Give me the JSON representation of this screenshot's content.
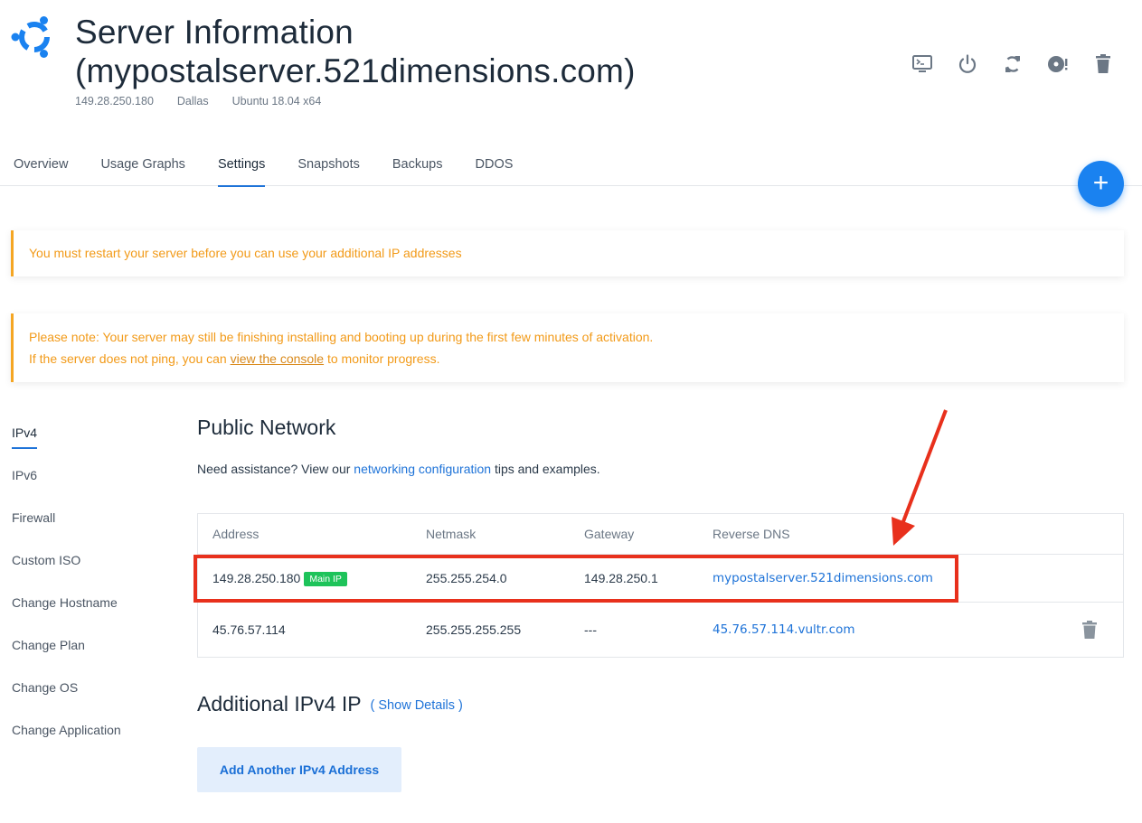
{
  "header": {
    "title_line1": "Server Information",
    "title_line2": "(mypostalserver.521dimensions.com)",
    "ip": "149.28.250.180",
    "location": "Dallas",
    "os": "Ubuntu 18.04 x64",
    "actions": [
      "console-icon",
      "power-icon",
      "restart-icon",
      "reinstall-icon",
      "trash-icon"
    ]
  },
  "tabs": [
    {
      "label": "Overview"
    },
    {
      "label": "Usage Graphs"
    },
    {
      "label": "Settings",
      "active": true
    },
    {
      "label": "Snapshots"
    },
    {
      "label": "Backups"
    },
    {
      "label": "DDOS"
    }
  ],
  "fab": {
    "label": "+"
  },
  "alerts": {
    "restart": "You must restart your server before you can use your additional IP addresses",
    "note_line1": "Please note: Your server may still be finishing installing and booting up during the first few minutes of activation.",
    "note_line2_pre": "If the server does not ping, you can ",
    "note_link": "view the console",
    "note_line2_post": " to monitor progress."
  },
  "sidenav": [
    {
      "label": "IPv4",
      "active": true
    },
    {
      "label": "IPv6"
    },
    {
      "label": "Firewall"
    },
    {
      "label": "Custom ISO"
    },
    {
      "label": "Change Hostname"
    },
    {
      "label": "Change Plan"
    },
    {
      "label": "Change OS"
    },
    {
      "label": "Change Application"
    }
  ],
  "main": {
    "title": "Public Network",
    "assist_pre": "Need assistance? View our ",
    "assist_link": "networking configuration",
    "assist_post": " tips and examples.",
    "columns": [
      "Address",
      "Netmask",
      "Gateway",
      "Reverse DNS"
    ],
    "rows": [
      {
        "address": "149.28.250.180",
        "badge": "Main IP",
        "netmask": "255.255.254.0",
        "gateway": "149.28.250.1",
        "rdns": "mypostalserver.521dimensions.com"
      },
      {
        "address": "45.76.57.114",
        "netmask": "255.255.255.255",
        "gateway": "---",
        "rdns": "45.76.57.114.vultr.com"
      }
    ],
    "additional_title": "Additional IPv4 IP",
    "show_details": "( Show Details )",
    "add_button": "Add Another IPv4 Address"
  },
  "colors": {
    "accent": "#1e73d8",
    "fab": "#1a82f0",
    "warning": "#f29a18",
    "badge": "#1ec35a",
    "highlight": "#e8301c"
  }
}
